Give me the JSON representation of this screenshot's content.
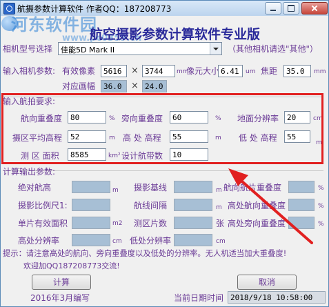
{
  "window": {
    "title": "航摄参数计算软件  作者QQ：187208773"
  },
  "watermark": {
    "site_name": "河东软件园",
    "site_url": "www.pc0359.cn"
  },
  "heading": "航空摄影参数计算软件专业版",
  "camera": {
    "label": "相机型号选择",
    "selected": "佳能5D Mark II",
    "other_hint": "（其他相机请选\"其他\"）"
  },
  "camera_params": {
    "label": "输入相机参数:",
    "pixels_label": "有效像素",
    "pixels_w": "5616",
    "pixels_h": "3744",
    "pixels_unit": "mm",
    "pixel_size_label": "像元大小",
    "pixel_size": "6.41",
    "pixel_size_unit": "um",
    "focal_label": "焦距",
    "focal": "35.0",
    "focal_unit": "mm",
    "frame_label": "对应画幅",
    "frame_w": "36.0",
    "frame_h": "24.0"
  },
  "requirements": {
    "section_label": "输入航拍要求:",
    "overlap_fwd_label": "航向重叠度",
    "overlap_fwd": "80",
    "overlap_side_label": "旁向重叠度",
    "overlap_side": "60",
    "gsd_label": "地面分辨率",
    "gsd": "20",
    "gsd_unit": "cm",
    "avg_elev_label": "摄区平均高程",
    "avg_elev": "52",
    "high_elev_label": "高 处 高程",
    "high_elev": "55",
    "low_elev_label": "低 处 高程",
    "low_elev": "55",
    "area_label": "测 区 面积",
    "area": "8585",
    "area_unit": "km²",
    "strips_label": "设计航带数",
    "strips": "10",
    "percent": "%",
    "meter": "m"
  },
  "outputs": {
    "section_label": "计算输出参数:",
    "abs_height_label": "绝对航高",
    "baseline_label": "摄影基线",
    "fwd_overlap_label": "航向航片重叠度",
    "scale_label": "摄影比例尺1:",
    "line_spacing_label": "航线间隔",
    "high_fwd_overlap_label": "高处航向重叠度",
    "ground_area_label": "单片有效面积",
    "photo_count_label": "测区片数",
    "high_side_overlap_label": "高处旁向重叠度",
    "high_res_label": "高处分辨率",
    "low_res_label": "低处分辨率",
    "unit_m": "m",
    "unit_m2": "m2",
    "unit_sheet": "张",
    "unit_cm": "cm",
    "unit_pct": "%"
  },
  "hint": {
    "line1": "提示：请注意高处的航向、旁向重叠度以及低处的分辨率。无人机适当加大重叠度!",
    "line2": "欢迎加QQ187208773交流!"
  },
  "buttons": {
    "calc": "计算",
    "cancel": "取消"
  },
  "footer": {
    "edited": "2016年3月编写",
    "date_label": "当前日期时间",
    "datetime": "2018/9/18  10:58:00"
  },
  "colors": {
    "annotation_red": "#e12020",
    "label_purple": "#6a3a96",
    "heading_blue": "#2a2a9a",
    "output_box": "#a7bfd5"
  }
}
